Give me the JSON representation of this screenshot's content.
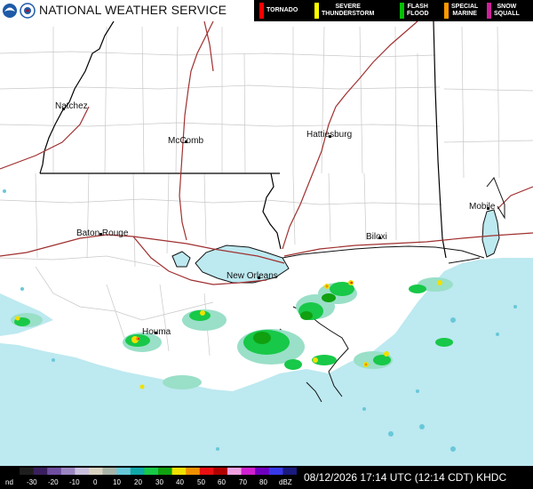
{
  "header": {
    "title": "NATIONAL WEATHER SERVICE",
    "logos": [
      "noaa-logo",
      "nws-logo"
    ]
  },
  "warnings": [
    {
      "line1": "TORNADO",
      "line2": "",
      "color": "#ff0000"
    },
    {
      "line1": "SEVERE",
      "line2": "THUNDERSTORM",
      "color": "#ffff00"
    },
    {
      "line1": "FLASH",
      "line2": "FLOOD",
      "color": "#00c000"
    },
    {
      "line1": "SPECIAL",
      "line2": "MARINE",
      "color": "#ff9900"
    },
    {
      "line1": "SNOW",
      "line2": "SQUALL",
      "color": "#cc2299"
    }
  ],
  "cities": [
    "Natchez",
    "McComb",
    "Hattiesburg",
    "Baton Rouge",
    "New Orleans",
    "Biloxi",
    "Mobile",
    "Houma"
  ],
  "legend": {
    "ticks": [
      "nd",
      "-30",
      "-20",
      "-10",
      "0",
      "10",
      "20",
      "30",
      "40",
      "50",
      "60",
      "70",
      "80",
      "dBZ"
    ],
    "colors": [
      "#1e1e1e",
      "#3a1f5e",
      "#6f4f9f",
      "#9a86c2",
      "#c8c0dc",
      "#d8d2c0",
      "#a8b4a8",
      "#68c8d8",
      "#10a8a8",
      "#18c848",
      "#10a010",
      "#f0e000",
      "#f09000",
      "#e81010",
      "#b00000",
      "#f0a0e0",
      "#d020d0",
      "#7000c0",
      "#3838e8",
      "#1a1a80"
    ]
  },
  "timestamp": "08/12/2026 17:14 UTC (12:14 CDT) KHDC",
  "colors": {
    "water": "#bde9f0",
    "land": "#ffffff",
    "state_line": "#000000",
    "county_line": "#c8c8c8",
    "highway": "#a03030"
  }
}
